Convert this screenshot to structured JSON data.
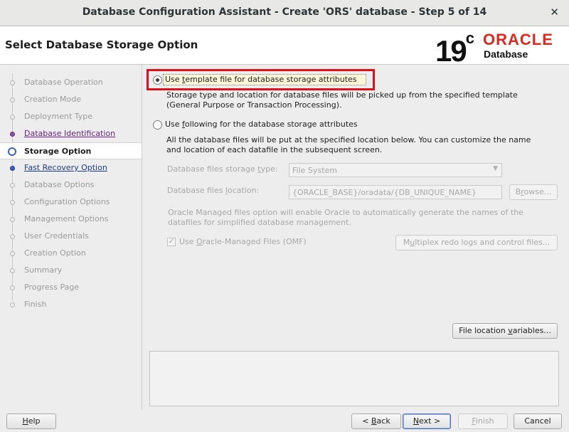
{
  "window": {
    "title": "Database Configuration Assistant - Create 'ORS' database - Step 5 of 14",
    "close_glyph": "✕"
  },
  "header": {
    "page_title": "Select Database Storage Option",
    "logo": {
      "version": "19",
      "version_sup": "c",
      "brand": "ORACLE",
      "product": "Database",
      "brand_color": "#e0281c"
    }
  },
  "steps": [
    {
      "label": "Database Operation",
      "state": "pending"
    },
    {
      "label": "Creation Mode",
      "state": "pending"
    },
    {
      "label": "Deployment Type",
      "state": "pending"
    },
    {
      "label": "Database Identification",
      "state": "done"
    },
    {
      "label": "Storage Option",
      "state": "current"
    },
    {
      "label": "Fast Recovery Option",
      "state": "link"
    },
    {
      "label": "Database Options",
      "state": "pending"
    },
    {
      "label": "Configuration Options",
      "state": "pending"
    },
    {
      "label": "Management Options",
      "state": "pending"
    },
    {
      "label": "User Credentials",
      "state": "pending"
    },
    {
      "label": "Creation Option",
      "state": "pending"
    },
    {
      "label": "Summary",
      "state": "pending"
    },
    {
      "label": "Progress Page",
      "state": "pending"
    },
    {
      "label": "Finish",
      "state": "pending"
    }
  ],
  "options": {
    "template": {
      "label_pre": "Use ",
      "label_mnemonic": "t",
      "label_post": "emplate file for database storage attributes",
      "description_line1": "Storage type and location for database files will be picked up from the specified template",
      "description_line2": "(General Purpose or Transaction Processing).",
      "selected": true
    },
    "following": {
      "label_pre": "Use ",
      "label_mnemonic": "f",
      "label_post": "ollowing for the database storage attributes",
      "description_line1": "All the database files will be put at the specified location below. You can customize the name",
      "description_line2": "and location of each datafile in the subsequent screen.",
      "selected": false
    }
  },
  "storage_type": {
    "label_pre": "Database files storage ",
    "label_mnemonic": "t",
    "label_post": "ype:",
    "value": "File System"
  },
  "files_location": {
    "label_pre": "Database files ",
    "label_mnemonic": "l",
    "label_post": "ocation:",
    "value": "{ORACLE_BASE}/oradata/{DB_UNIQUE_NAME}",
    "browse_pre": "B",
    "browse_mnemonic": "r",
    "browse_post": "owse..."
  },
  "omf_note_line1": "Oracle Managed files option will enable Oracle to automatically generate the names of the",
  "omf_note_line2": "datafiles for simplified database management.",
  "omf_checkbox": {
    "label_pre": "Use ",
    "label_mnemonic": "O",
    "label_post": "racle-Managed Files (OMF)",
    "checked": true
  },
  "multiplex_button": {
    "label_pre": "M",
    "label_mnemonic": "u",
    "label_post": "ltiplex redo logs and control files..."
  },
  "file_location_variables_button": {
    "label_pre": "File location ",
    "label_mnemonic": "v",
    "label_post": "ariables..."
  },
  "footer": {
    "help": {
      "mnemonic": "H",
      "rest": "elp"
    },
    "back": {
      "pre": "< ",
      "mnemonic": "B",
      "rest": "ack"
    },
    "next": {
      "mnemonic": "N",
      "rest": "ext >"
    },
    "finish": {
      "mnemonic": "F",
      "rest": "inish"
    },
    "cancel": {
      "label": "Cancel"
    }
  }
}
